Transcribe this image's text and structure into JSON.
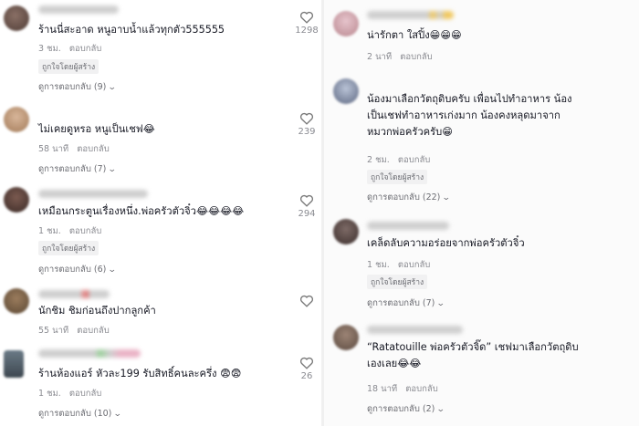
{
  "left": [
    {
      "text": "ร้านนี่สะอาด หนูอาบน้ำแล้วทุกตัว555555",
      "time": "3 ชม.",
      "reply": "ตอบกลับ",
      "badge": "ถูกใจโดยผู้สร้าง",
      "view": "ดูการตอบกลับ (9)",
      "likes": "1298"
    },
    {
      "text": "ไม่เคยดูหรอ หนูเป็นเชฟ😂",
      "time": "58 นาที",
      "reply": "ตอบกลับ",
      "badge": "",
      "view": "ดูการตอบกลับ (7)",
      "likes": "239"
    },
    {
      "text": "เหมือนกระตูนเรื่องหนึ่ง.พ่อครัวตัวจิ๋ว😂😂😂😂",
      "time": "1 ชม.",
      "reply": "ตอบกลับ",
      "badge": "ถูกใจโดยผู้สร้าง",
      "view": "ดูการตอบกลับ (6)",
      "likes": "294"
    },
    {
      "text": "นักชิม ชิมก่อนถึงปากลูกค้า",
      "time": "55 นาที",
      "reply": "ตอบกลับ",
      "badge": "",
      "view": "",
      "likes": ""
    },
    {
      "text": "ร้านห้องแอร์ หัวละ199 รับสิทธิ์คนละครึ่ง 😨😨",
      "time": "1 ชม.",
      "reply": "ตอบกลับ",
      "badge": "",
      "view": "ดูการตอบกลับ (10)",
      "likes": "26"
    }
  ],
  "right": [
    {
      "lines": [
        "น่ารักตา ใสปิ้ง😁😁😁"
      ],
      "time": "2 นาที",
      "reply": "ตอบกลับ",
      "badge": "",
      "view": ""
    },
    {
      "lines": [
        "น้องมาเลือกวัตถุดิบครับ เพื่อนไปทำอาหาร น้อง",
        "เป็นเชฟทำอาหารเก่งมาก น้องคงหลุดมาจาก",
        "หมวกพ่อครัวครับ😁"
      ],
      "time": "2 ชม.",
      "reply": "ตอบกลับ",
      "badge": "ถูกใจโดยผู้สร้าง",
      "view": "ดูการตอบกลับ (22)"
    },
    {
      "lines": [
        "เคล็ดลับความอร่อยจากพ่อครัวตัวจิ๋ว"
      ],
      "time": "1 ชม.",
      "reply": "ตอบกลับ",
      "badge": "ถูกใจโดยผู้สร้าง",
      "view": "ดูการตอบกลับ (7)"
    },
    {
      "lines": [
        "“Ratatouille พ่อครัวตัวจิ๊ด” เชฟมาเลือกวัตถุดิบ",
        "เองเลย😂😂"
      ],
      "time": "18 นาที",
      "reply": "ตอบกลับ",
      "badge": "",
      "view": "ดูการตอบกลับ (2)"
    }
  ],
  "colors": {
    "text": "#161823",
    "meta": "#8a8b91",
    "badge_bg": "#f1f1f2"
  },
  "icons": {
    "like": "heart-outline-icon",
    "chevron": "chevron-down-icon"
  }
}
